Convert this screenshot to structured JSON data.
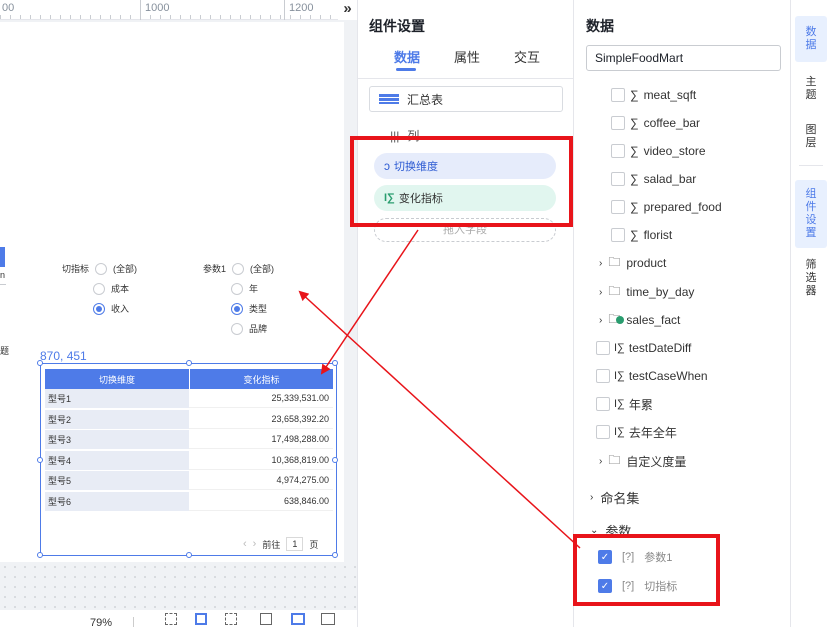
{
  "ruler": {
    "marks": [
      "00",
      "1000",
      "1200"
    ],
    "collapse_icon": "double-chevron-right-icon"
  },
  "canvas": {
    "filters": {
      "left": {
        "label": "切指标",
        "options": [
          "(全部)",
          "成本",
          "收入"
        ],
        "selected": 2
      },
      "right": {
        "label": "参数1",
        "options": [
          "(全部)",
          "年",
          "类型",
          "品牌"
        ],
        "selected": 2
      }
    },
    "coord": "870, 451",
    "table": {
      "headers": [
        "切换维度",
        "变化指标"
      ],
      "rows": [
        [
          "型号1",
          "25,339,531.00"
        ],
        [
          "型号2",
          "23,658,392.20"
        ],
        [
          "型号3",
          "17,498,288.00"
        ],
        [
          "型号4",
          "10,368,819.00"
        ],
        [
          "型号5",
          "4,974,275.00"
        ],
        [
          "型号6",
          "638,846.00"
        ]
      ],
      "pager": {
        "prev": "‹",
        "next": "›",
        "goto": "前往",
        "page": "1",
        "unit": "页"
      }
    },
    "edge_text": {
      "a": "n",
      "b": "题"
    },
    "zoom": "79%"
  },
  "mid_panel": {
    "title": "组件设置",
    "tabs": [
      "数据",
      "属性",
      "交互"
    ],
    "active_tab": 0,
    "chart_type": "汇总表",
    "section_label": "列",
    "fields": [
      {
        "label": "切换维度",
        "icon": "switch-dimension-icon"
      },
      {
        "label": "变化指标",
        "icon": "measure-icon"
      }
    ],
    "drop_placeholder": "拖入字段"
  },
  "right_panel": {
    "title": "数据",
    "dataset": "SimpleFoodMart",
    "measures": [
      "meat_sqft",
      "coffee_bar",
      "video_store",
      "salad_bar",
      "prepared_food",
      "florist"
    ],
    "folders": [
      "product",
      "time_by_day",
      "sales_fact"
    ],
    "calc_measures": [
      "testDateDiff",
      "testCaseWhen",
      "年累",
      "去年全年"
    ],
    "custom_folder": "自定义度量",
    "named_sets": "命名集",
    "params_label": "参数",
    "params": [
      "参数1",
      "切指标"
    ],
    "param_icon_text": "[?]"
  },
  "side_nav": [
    "数据",
    "主题",
    "图层",
    "组件设置",
    "筛选器"
  ],
  "colors": {
    "accent": "#4e7be8",
    "highlight": "#e8141a"
  }
}
